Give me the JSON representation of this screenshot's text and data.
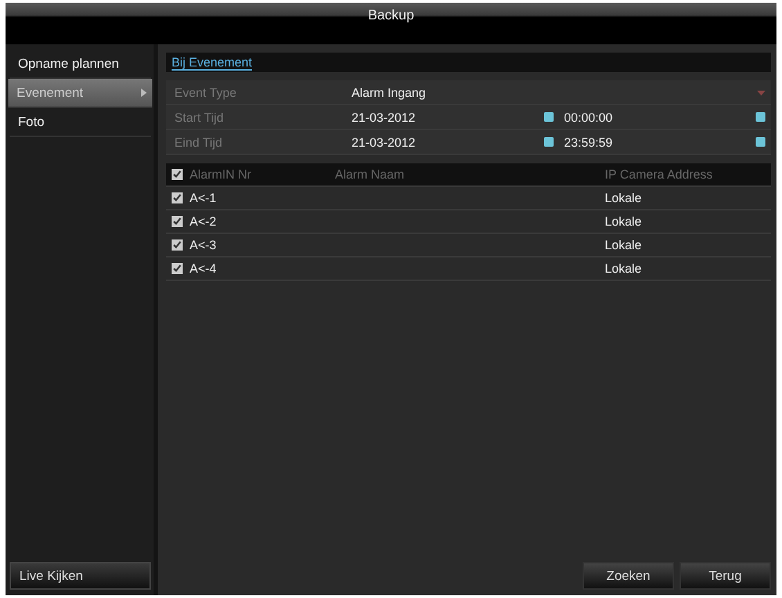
{
  "window": {
    "title": "Backup"
  },
  "sidebar": {
    "items": [
      {
        "label": "Opname plannen",
        "selected": false
      },
      {
        "label": "Evenement",
        "selected": true
      },
      {
        "label": "Foto",
        "selected": false
      }
    ],
    "footer_button": "Live Kijken"
  },
  "tabs": [
    {
      "label": "Bij Evenement",
      "selected": true
    }
  ],
  "form": {
    "event_type": {
      "label": "Event Type",
      "value": "Alarm Ingang"
    },
    "start": {
      "label": "Start Tijd",
      "date": "21-03-2012",
      "time": "00:00:00"
    },
    "end": {
      "label": "Eind Tijd",
      "date": "21-03-2012",
      "time": "23:59:59"
    }
  },
  "table": {
    "header_checked": true,
    "columns": [
      "AlarmIN Nr",
      "Alarm Naam",
      "IP Camera Address"
    ],
    "rows": [
      {
        "checked": true,
        "cells": [
          "A<-1",
          "",
          "Lokale"
        ]
      },
      {
        "checked": true,
        "cells": [
          "A<-2",
          "",
          "Lokale"
        ]
      },
      {
        "checked": true,
        "cells": [
          "A<-3",
          "",
          "Lokale"
        ]
      },
      {
        "checked": true,
        "cells": [
          "A<-4",
          "",
          "Lokale"
        ]
      }
    ]
  },
  "buttons": [
    "Zoeken",
    "Terug"
  ]
}
